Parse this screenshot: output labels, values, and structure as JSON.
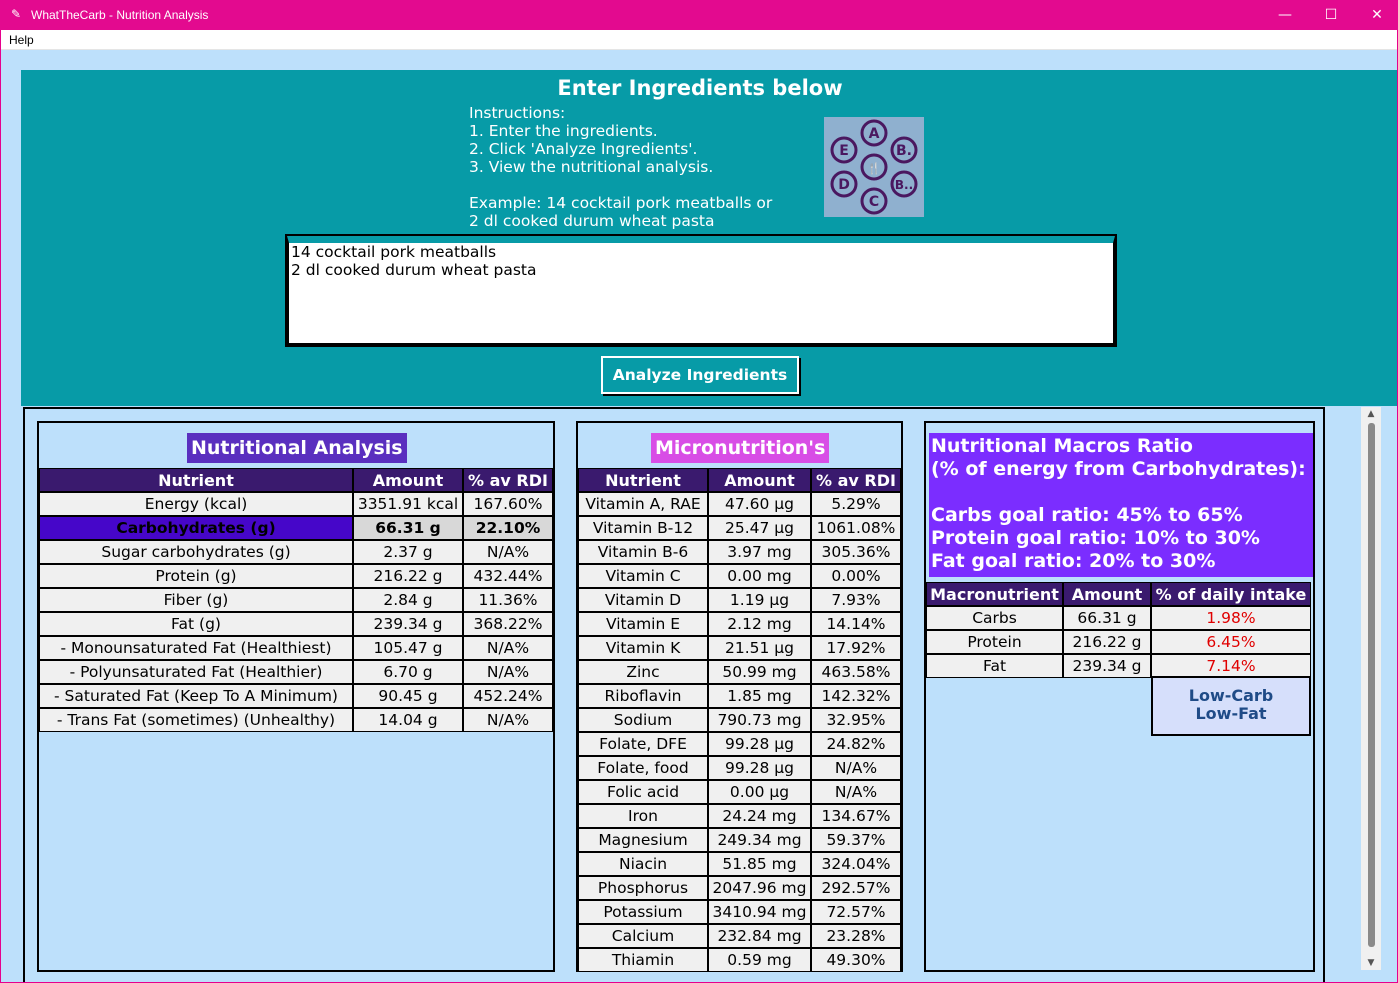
{
  "window": {
    "title": "WhatTheCarb - Nutrition Analysis",
    "app_icon": "feather-icon",
    "minimize": "—",
    "maximize": "☐",
    "close": "✕"
  },
  "menu": {
    "items": [
      "Help"
    ]
  },
  "input": {
    "heading": "Enter Ingredients below",
    "instructions": "Instructions:\n1. Enter the ingredients.\n2. Click 'Analyze Ingredients'.\n3. View the nutritional analysis.\n\nExample: 14 cocktail pork meatballs or\n2 dl cooked durum wheat pasta",
    "logo_letters": [
      "A",
      "B.",
      "B..",
      "C",
      "D",
      "E"
    ],
    "ingredients_value": "14 cocktail pork meatballs\n2 dl cooked durum wheat pasta",
    "analyze_label": "Analyze Ingredients"
  },
  "nutrition": {
    "title": "Nutritional Analysis",
    "headers": [
      "Nutrient",
      "Amount",
      "% av RDI"
    ],
    "rows": [
      [
        "Energy (kcal)",
        "3351.91 kcal",
        "167.60%"
      ],
      [
        "Carbohydrates (g)",
        "66.31 g",
        "22.10%"
      ],
      [
        "Sugar carbohydrates (g)",
        "2.37 g",
        "N/A%"
      ],
      [
        "Protein (g)",
        "216.22 g",
        "432.44%"
      ],
      [
        "Fiber (g)",
        "2.84 g",
        "11.36%"
      ],
      [
        "Fat (g)",
        "239.34 g",
        "368.22%"
      ],
      [
        "- Monounsaturated Fat (Healthiest)",
        "105.47 g",
        "N/A%"
      ],
      [
        "- Polyunsaturated Fat (Healthier)",
        "6.70 g",
        "N/A%"
      ],
      [
        "- Saturated Fat (Keep To A Minimum)",
        "90.45 g",
        "452.24%"
      ],
      [
        "- Trans Fat (sometimes) (Unhealthy)",
        "14.04 g",
        "N/A%"
      ]
    ]
  },
  "micro": {
    "title": "Micronutrition's",
    "headers": [
      "Nutrient",
      "Amount",
      "% av RDI"
    ],
    "rows": [
      [
        "Vitamin A, RAE",
        "47.60 µg",
        "5.29%"
      ],
      [
        "Vitamin B-12",
        "25.47 µg",
        "1061.08%"
      ],
      [
        "Vitamin B-6",
        "3.97 mg",
        "305.36%"
      ],
      [
        "Vitamin C",
        "0.00 mg",
        "0.00%"
      ],
      [
        "Vitamin D",
        "1.19 µg",
        "7.93%"
      ],
      [
        "Vitamin E",
        "2.12 mg",
        "14.14%"
      ],
      [
        "Vitamin K",
        "21.51 µg",
        "17.92%"
      ],
      [
        "Zinc",
        "50.99 mg",
        "463.58%"
      ],
      [
        "Riboflavin",
        "1.85 mg",
        "142.32%"
      ],
      [
        "Sodium",
        "790.73 mg",
        "32.95%"
      ],
      [
        "Folate, DFE",
        "99.28 µg",
        "24.82%"
      ],
      [
        "Folate, food",
        "99.28 µg",
        "N/A%"
      ],
      [
        "Folic acid",
        "0.00 µg",
        "N/A%"
      ],
      [
        "Iron",
        "24.24 mg",
        "134.67%"
      ],
      [
        "Magnesium",
        "249.34 mg",
        "59.37%"
      ],
      [
        "Niacin",
        "51.85 mg",
        "324.04%"
      ],
      [
        "Phosphorus",
        "2047.96 mg",
        "292.57%"
      ],
      [
        "Potassium",
        "3410.94 mg",
        "72.57%"
      ],
      [
        "Calcium",
        "232.84 mg",
        "23.28%"
      ],
      [
        "Thiamin",
        "0.59 mg",
        "49.30%"
      ]
    ]
  },
  "macros": {
    "info": "Nutritional Macros Ratio\n(% of energy from Carbohydrates):\n\nCarbs goal ratio: 45% to 65%\nProtein goal ratio: 10% to 30%\nFat goal ratio: 20% to 30%",
    "headers": [
      "Macronutrient",
      "Amount",
      "% of daily intake"
    ],
    "rows": [
      [
        "Carbs",
        "66.31 g",
        "1.98%"
      ],
      [
        "Protein",
        "216.22 g",
        "6.45%"
      ],
      [
        "Fat",
        "239.34 g",
        "7.14%"
      ]
    ],
    "pct_color": "#e00000",
    "diet_labels": [
      "Low-Carb",
      "Low-Fat"
    ]
  },
  "colors": {
    "titlebar": "#e30a8f",
    "input_panel": "#079ba7",
    "background": "#bde0fb",
    "header": "#3a1a6e",
    "highlight": "#4606c9",
    "nutrition_title": "#5a2fbf",
    "micro_title": "#d84de6",
    "macros_info": "#7b2dff"
  }
}
